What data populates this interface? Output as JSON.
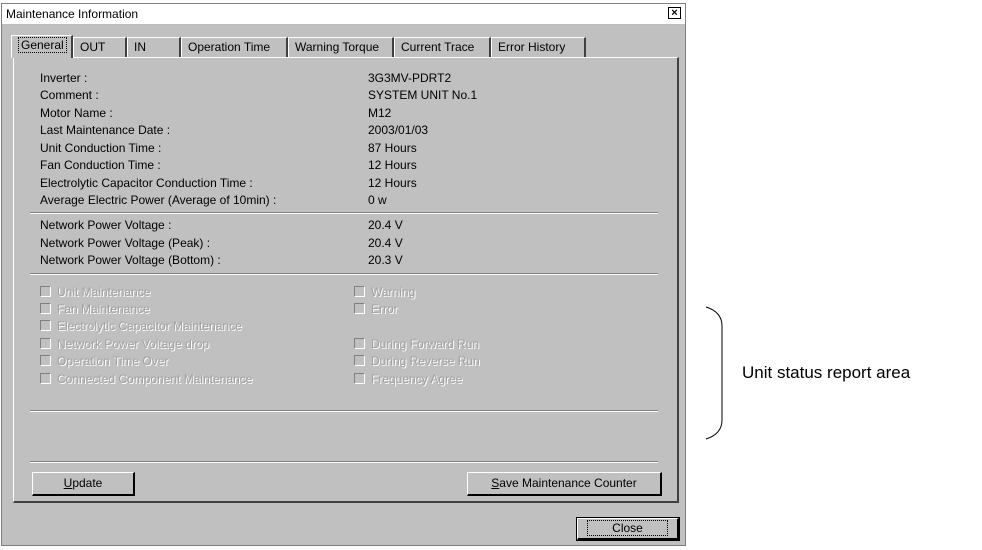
{
  "window": {
    "title": "Maintenance Information",
    "close_glyph": "×"
  },
  "tabs": [
    "General",
    "OUT",
    "IN",
    "Operation Time",
    "Warning Torque",
    "Current Trace",
    "Error History"
  ],
  "info": [
    {
      "label": "Inverter :",
      "value": "3G3MV-PDRT2"
    },
    {
      "label": "Comment :",
      "value": "SYSTEM UNIT No.1"
    },
    {
      "label": "Motor Name :",
      "value": "M12"
    },
    {
      "label": "Last Maintenance Date :",
      "value": "2003/01/03"
    },
    {
      "label": "Unit Conduction Time :",
      "value": "87 Hours"
    },
    {
      "label": "Fan Conduction Time :",
      "value": "12 Hours"
    },
    {
      "label": "Electrolytic Capacitor Conduction Time :",
      "value": "12 Hours"
    },
    {
      "label": "Average Electric Power (Average of 10min) :",
      "value": "0 w"
    }
  ],
  "voltage": [
    {
      "label": "Network Power Voltage :",
      "value": "20.4 V"
    },
    {
      "label": "Network Power Voltage (Peak) :",
      "value": "20.4 V"
    },
    {
      "label": "Network Power Voltage (Bottom) :",
      "value": "20.3 V"
    }
  ],
  "status_left": [
    "Unit Maintenance",
    "Fan Maintenance",
    "Electrolytic Capacitor Maintenance",
    "Network Power Voltage drop",
    "Operation Time Over",
    "Connected Component Maintenance"
  ],
  "status_right": [
    "Warning",
    "Error",
    "During Forward Run",
    "During Reverse Run",
    "Frequency Agree"
  ],
  "buttons": {
    "update_u": "U",
    "update_rest": "pdate",
    "save_u": "S",
    "save_rest": "ave Maintenance Counter",
    "close": "Close"
  },
  "annotation": "Unit status report area"
}
